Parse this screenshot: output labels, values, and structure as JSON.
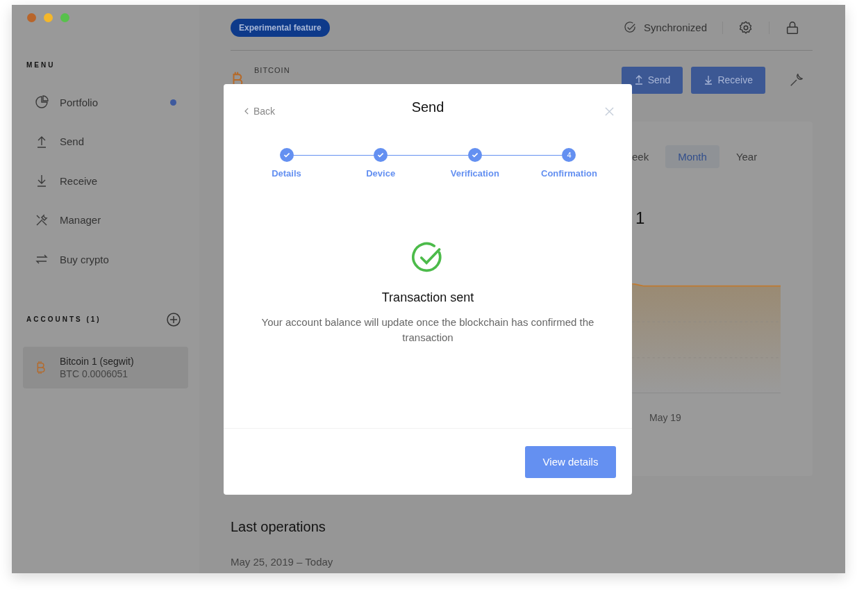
{
  "sidebar": {
    "menu_title": "MENU",
    "items": [
      {
        "label": "Portfolio",
        "notification": true
      },
      {
        "label": "Send",
        "notification": false
      },
      {
        "label": "Receive",
        "notification": false
      },
      {
        "label": "Manager",
        "notification": false
      },
      {
        "label": "Buy crypto",
        "notification": false
      }
    ],
    "accounts_title": "ACCOUNTS (1)",
    "accounts": [
      {
        "name": "Bitcoin 1 (segwit)",
        "balance": "BTC 0.0006051"
      }
    ]
  },
  "top_bar": {
    "badge": "Experimental feature",
    "sync_status": "Synchronized"
  },
  "account_header": {
    "currency": "BITCOIN",
    "buttons": [
      "Send",
      "Receive"
    ]
  },
  "chart_card": {
    "periods": [
      {
        "label": "eek",
        "selected": false
      },
      {
        "label": "Month",
        "selected": true
      },
      {
        "label": "Year",
        "selected": false
      }
    ],
    "balance": "1",
    "x_label": "May 19"
  },
  "last_operations": {
    "title": "Last operations",
    "date": "May 25, 2019 – Today"
  },
  "modal": {
    "back": "Back",
    "title": "Send",
    "steps": [
      {
        "label": "Details",
        "done": true
      },
      {
        "label": "Device",
        "done": true
      },
      {
        "label": "Verification",
        "done": true
      },
      {
        "label": "Confirmation",
        "done": false,
        "number": "4"
      }
    ],
    "heading": "Transaction sent",
    "message": "Your account balance will update once the blockchain has confirmed the transaction",
    "button": "View details"
  }
}
